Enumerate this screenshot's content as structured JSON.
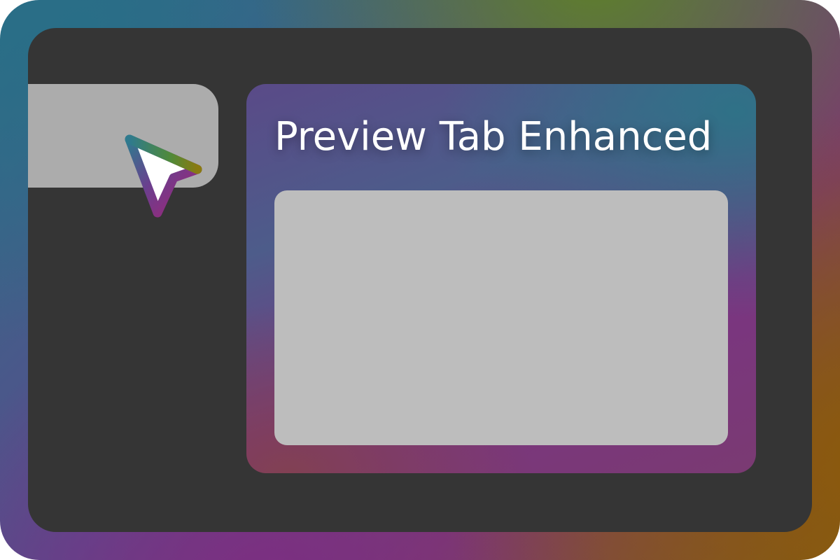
{
  "preview_panel": {
    "title": "Preview Tab Enhanced"
  },
  "icons": {
    "cursor": "pointer-cursor-icon"
  },
  "colors": {
    "window_background": "#353535",
    "tab_background": "#acacac",
    "preview_area_background": "#bdbdbd",
    "title_text": "#ffffff"
  }
}
